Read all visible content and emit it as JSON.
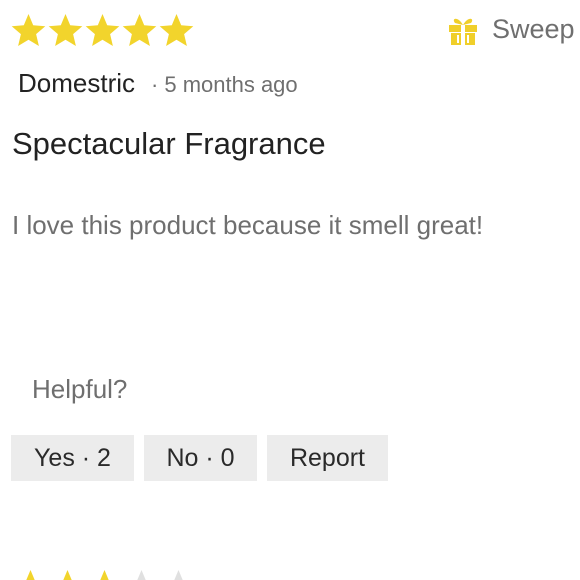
{
  "review": {
    "rating": 5,
    "rating_max": 5,
    "author": "Domestric",
    "separator": "·",
    "time_ago": "5 months ago",
    "title": "Spectacular Fragrance",
    "body": "I love this product because it smell great!"
  },
  "badge": {
    "icon": "gift-icon",
    "label": "Sweep"
  },
  "helpful": {
    "prompt": "Helpful?",
    "yes_label": "Yes · 2",
    "no_label": "No · 0",
    "report_label": "Report"
  },
  "colors": {
    "star": "#f2d42c",
    "star_empty": "#e0e0e0",
    "gift": "#f0cf2a",
    "button_bg": "#ececec"
  }
}
